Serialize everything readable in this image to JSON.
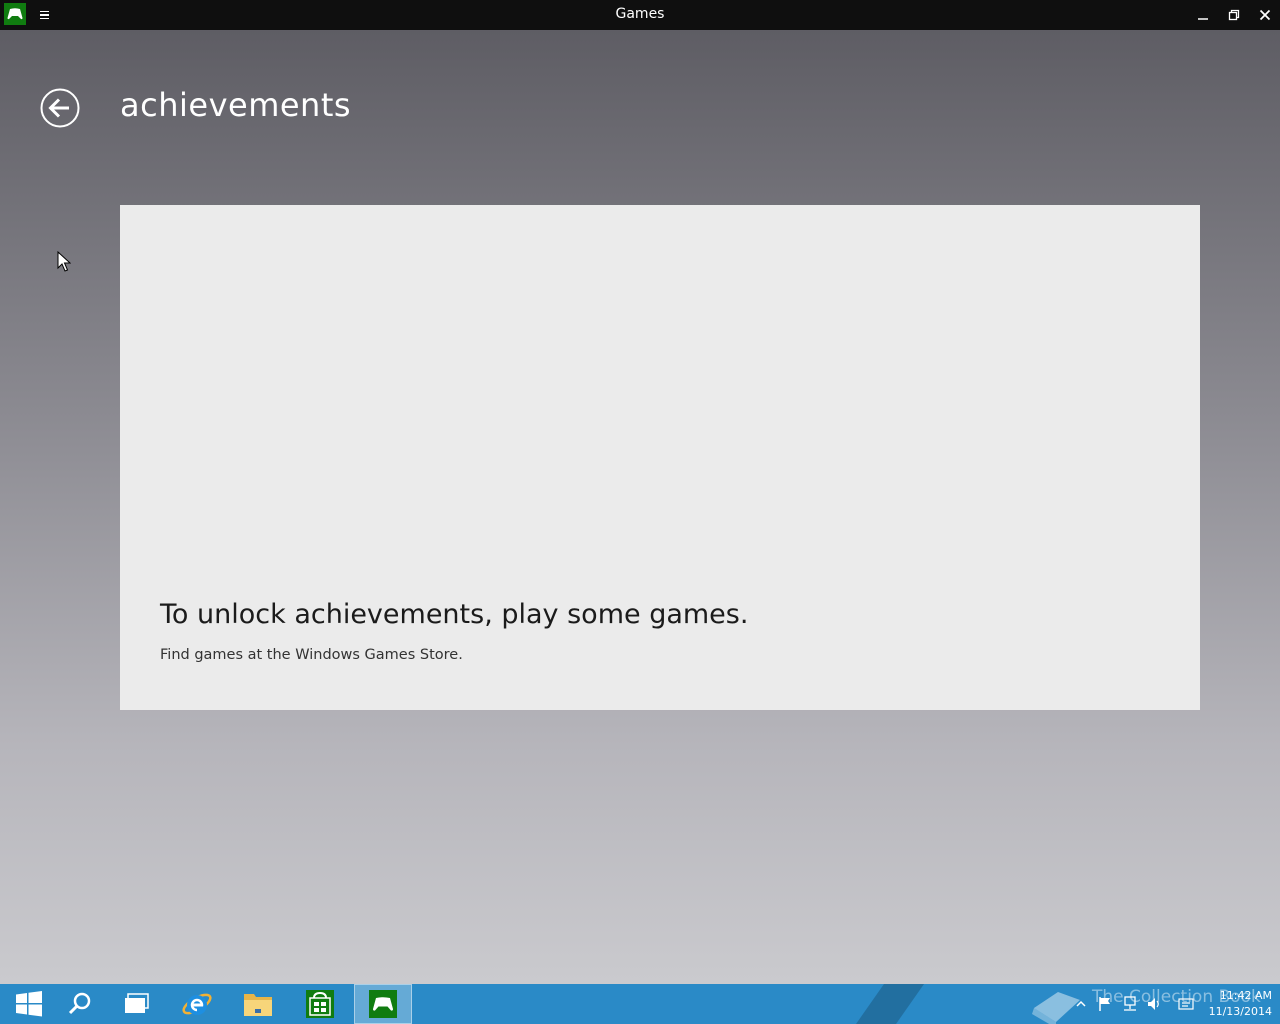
{
  "window": {
    "title": "Games"
  },
  "page": {
    "title": "achievements"
  },
  "empty_state": {
    "heading": "To unlock achievements, play some games.",
    "subtext": "Find games at the Windows Games Store."
  },
  "taskbar": {
    "apps": [
      "start-icon",
      "search-icon",
      "task-view-icon",
      "internet-explorer-icon",
      "file-explorer-icon",
      "store-icon",
      "games-icon"
    ],
    "watermark": "The Collection Book",
    "clock": {
      "time": "11:42 AM",
      "date": "11/13/2014"
    }
  },
  "colors": {
    "title_bar": "#0f0f0f",
    "accent_green": "#107c10",
    "panel": "#ebebeb",
    "taskbar": "#2a8ac7"
  }
}
